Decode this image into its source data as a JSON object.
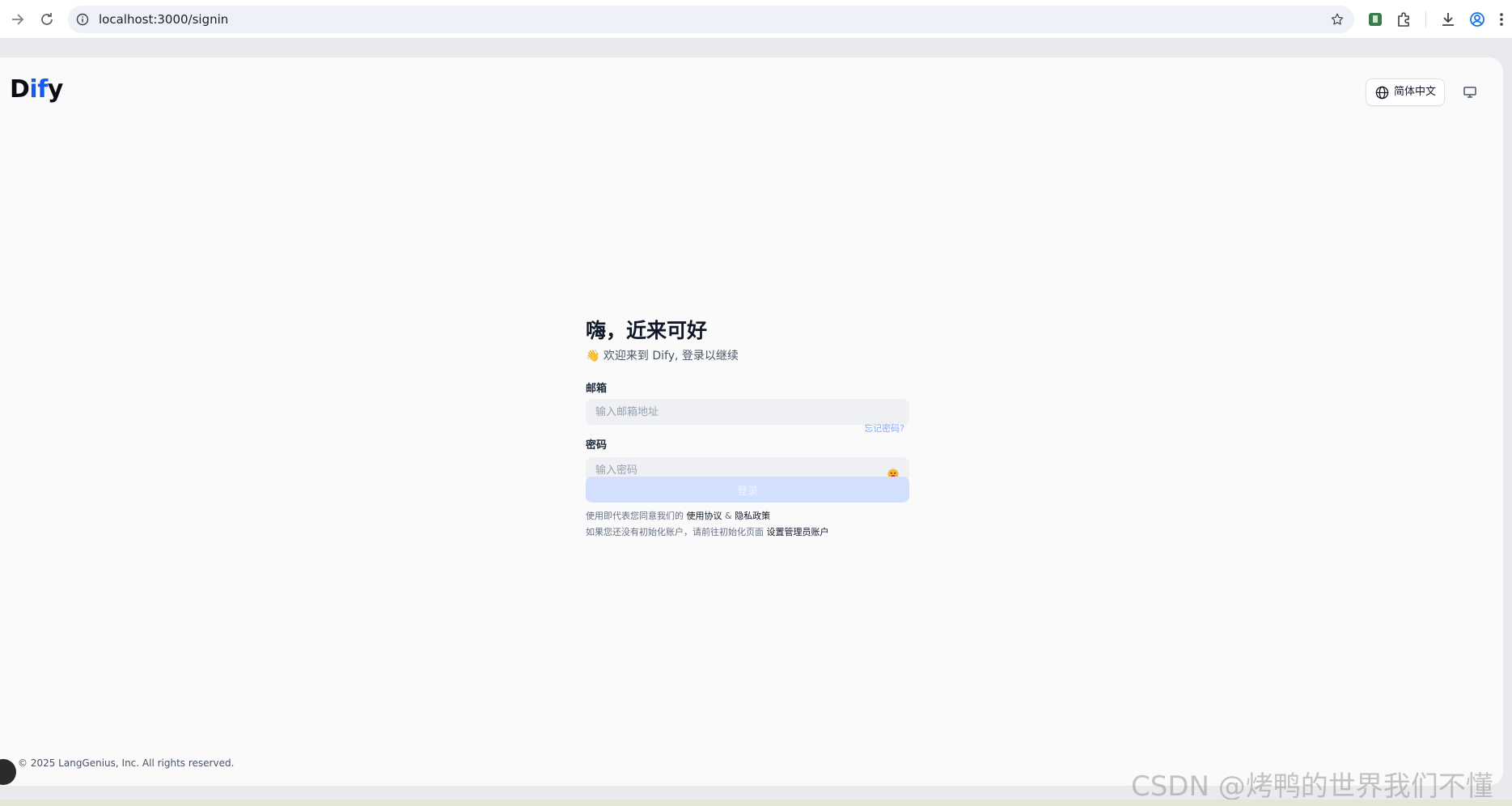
{
  "browser": {
    "url": "localhost:3000/signin",
    "icons": [
      "forward-icon",
      "reload-icon",
      "info-icon",
      "star-icon",
      "extension-green-icon",
      "puzzle-icon",
      "download-icon",
      "profile-icon",
      "menu-icon"
    ]
  },
  "header": {
    "logo_part1": "D",
    "logo_part2": "if",
    "logo_part3": "y",
    "language_label": "简体中文"
  },
  "signin": {
    "title": "嗨，近来可好",
    "subtitle_emoji": "👋",
    "subtitle": "欢迎来到 Dify, 登录以继续",
    "email_label": "邮箱",
    "email_placeholder": "输入邮箱地址",
    "password_label": "密码",
    "forgot_password": "忘记密码?",
    "password_placeholder": "输入密码",
    "signin_button": "登录",
    "terms_prefix": "使用即代表您同意我们的",
    "terms_link": "使用协议",
    "terms_and": "&",
    "privacy_link": "隐私政策",
    "init_prefix": "如果您还没有初始化账户，请前往初始化页面",
    "init_link": "设置管理员账户"
  },
  "footer": {
    "copyright": "© 2025 LangGenius, Inc. All rights reserved."
  },
  "watermark": "CSDN @烤鸭的世界我们不懂",
  "colors": {
    "brand_blue": "#155aef",
    "page_bg": "#fafafa",
    "input_bg": "#eff0f3",
    "button_disabled": "#d3e0fd"
  }
}
